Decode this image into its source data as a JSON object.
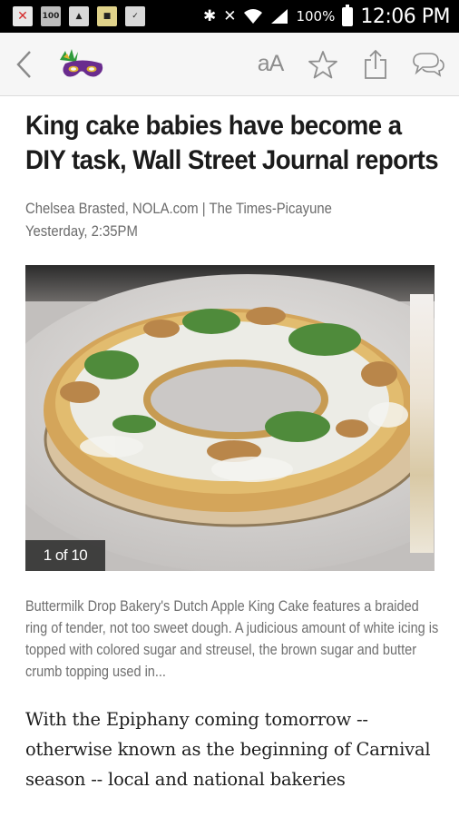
{
  "status_bar": {
    "battery_percent": "100%",
    "time": "12:06 PM",
    "icons": [
      "notification-x-icon",
      "notification-100-icon",
      "gallery-icon",
      "app-icon",
      "clipboard-check-icon",
      "bluetooth-icon",
      "mute-icon",
      "wifi-icon",
      "signal-icon",
      "battery-icon"
    ]
  },
  "app_bar": {
    "font_size_label": "aA",
    "icons": [
      "back-icon",
      "mardi-gras-mask-logo",
      "font-size-icon",
      "star-icon",
      "share-icon",
      "comments-icon"
    ]
  },
  "article": {
    "headline": "King cake babies have become a DIY task, Wall Street Journal reports",
    "byline_author": "Chelsea Brasted, NOLA.com | The Times-Picayune",
    "byline_time": "Yesterday, 2:35PM",
    "photo_count": "1 of 10",
    "caption": "Buttermilk Drop Bakery's Dutch Apple King Cake features a braided ring of tender, not too sweet dough. A judicious amount of white icing is topped with colored sugar and streusel, the brown sugar and butter crumb topping used in...",
    "body_start": "With the Epiphany coming tomorrow -- otherwise known as the beginning of Carnival season -- local and national bakeries"
  },
  "colors": {
    "status_bar_bg": "#000000",
    "app_bar_bg": "#f6f6f6",
    "mask_purple": "#6a2c8e",
    "mask_gold": "#e0b22e",
    "mask_green": "#2e9b3a"
  }
}
